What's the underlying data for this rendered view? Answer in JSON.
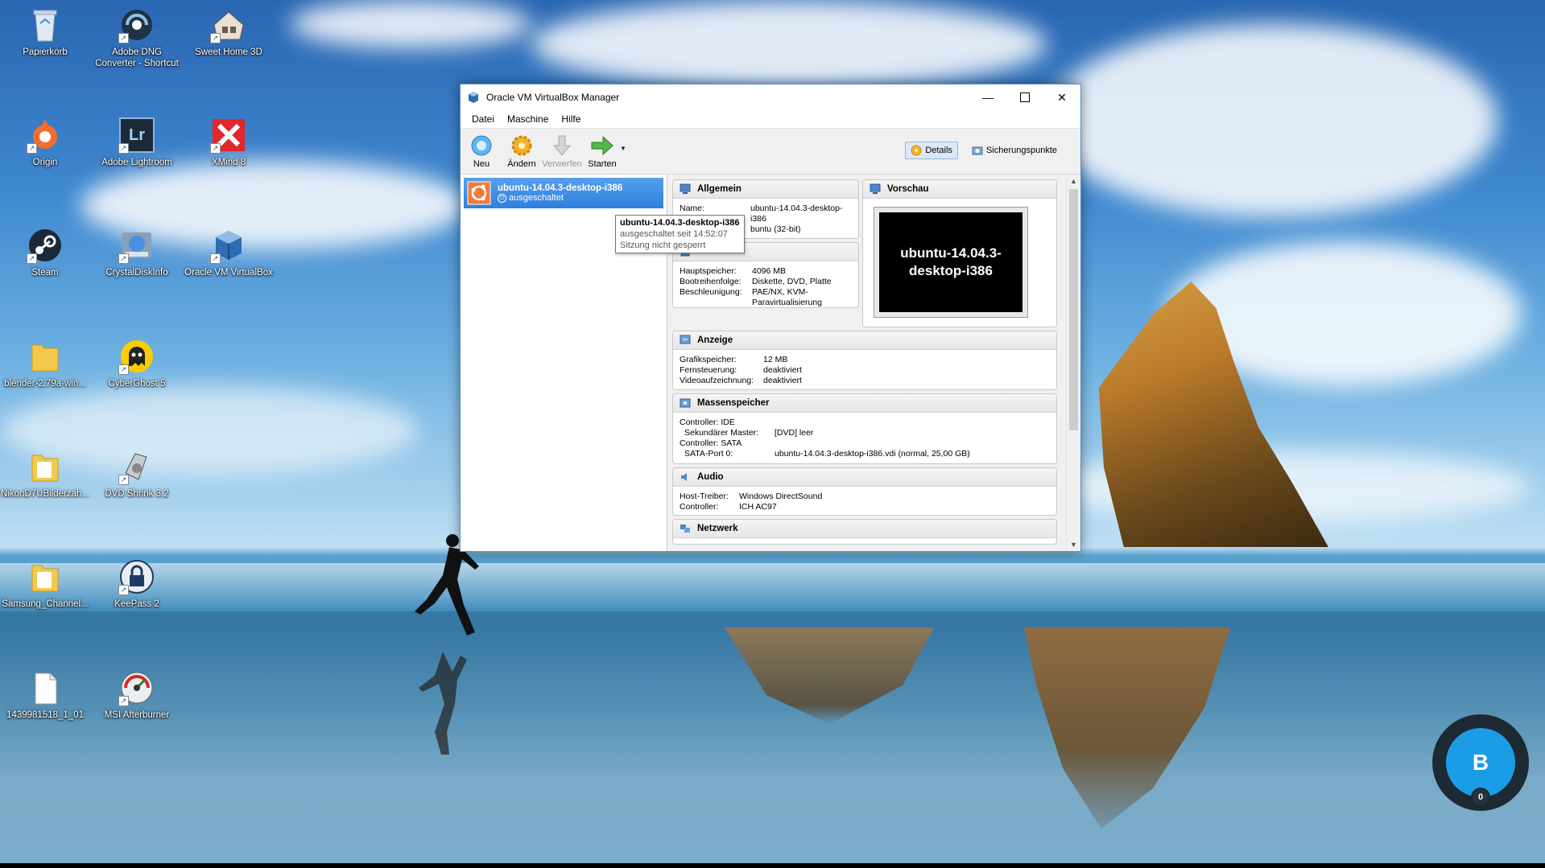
{
  "desktop": {
    "icons": [
      {
        "label": "Papierkorb",
        "icon": "recycle-bin-icon"
      },
      {
        "label": "Adobe DNG Converter - Shortcut",
        "icon": "adobe-dng-icon"
      },
      {
        "label": "Sweet Home 3D",
        "icon": "sweet-home-icon"
      },
      {
        "label": "Origin",
        "icon": "origin-icon"
      },
      {
        "label": "Adobe Lightroom",
        "icon": "lightroom-icon",
        "glyph": "Lr"
      },
      {
        "label": "XMind 8",
        "icon": "xmind-icon"
      },
      {
        "label": "Steam",
        "icon": "steam-icon"
      },
      {
        "label": "CrystalDiskInfo",
        "icon": "crystaldiskinfo-icon"
      },
      {
        "label": "Oracle VM VirtualBox",
        "icon": "virtualbox-icon"
      },
      {
        "label": "blender-2.79a-win...",
        "icon": "folder-icon"
      },
      {
        "label": "CyberGhost 5",
        "icon": "cyberghost-icon"
      },
      {
        "label": "NikonD7UBilderzah...",
        "icon": "folder-icon"
      },
      {
        "label": "DVD Shrink 3.2",
        "icon": "dvd-shrink-icon"
      },
      {
        "label": "Samsung_Channel...",
        "icon": "folder-icon"
      },
      {
        "label": "KeePass 2",
        "icon": "keepass-icon"
      },
      {
        "label": "1439981518_1_01",
        "icon": "file-icon"
      },
      {
        "label": "MSI Afterburner",
        "icon": "msi-afterburner-icon"
      }
    ]
  },
  "window": {
    "title": "Oracle VM VirtualBox Manager",
    "menu": [
      "Datei",
      "Maschine",
      "Hilfe"
    ],
    "toolbar": {
      "new_label": "Neu",
      "settings_label": "Ändern",
      "discard_label": "Verwerfen",
      "start_label": "Starten",
      "details_label": "Details",
      "snapshots_label": "Sicherungspunkte"
    },
    "vm": {
      "name": "ubuntu-14.04.3-desktop-i386",
      "state": "ausgeschaltet"
    },
    "tooltip": {
      "title": "ubuntu-14.04.3-desktop-i386",
      "line1": "ausgeschaltet seit 14:52:07",
      "line2": "Sitzung nicht gesperrt"
    },
    "sections": {
      "general": {
        "title": "Allgemein",
        "name_key": "Name:",
        "name_val": "ubuntu-14.04.3-desktop-i386",
        "os_val": "buntu (32-bit)"
      },
      "system": {
        "memory_key": "Hauptspeicher:",
        "memory_val": "4096 MB",
        "boot_key": "Bootreihenfolge:",
        "boot_val": "Diskette, DVD, Platte",
        "accel_key": "Beschleunigung:",
        "accel_val": "PAE/NX, KVM-Paravirtualisierung"
      },
      "preview": {
        "title": "Vorschau",
        "screen_text": "ubuntu-14.04.3-desktop-i386"
      },
      "display": {
        "title": "Anzeige",
        "vram_key": "Grafikspeicher:",
        "vram_val": "12 MB",
        "remote_key": "Fernsteuerung:",
        "remote_val": "deaktiviert",
        "capture_key": "Videoaufzeichnung:",
        "capture_val": "deaktiviert"
      },
      "storage": {
        "title": "Massenspeicher",
        "ctrl_ide": "Controller: IDE",
        "sec_master_key": "Sekundärer Master:",
        "sec_master_val": "[DVD] leer",
        "ctrl_sata": "Controller: SATA",
        "sata_port_key": "SATA-Port 0:",
        "sata_port_val": "ubuntu-14.04.3-desktop-i386.vdi (normal, 25,00 GB)"
      },
      "audio": {
        "title": "Audio",
        "host_key": "Host-Treiber:",
        "host_val": "Windows DirectSound",
        "ctrl_key": "Controller:",
        "ctrl_val": "ICH AC97"
      },
      "network": {
        "title": "Netzwerk"
      }
    }
  },
  "badge": {
    "letter": "B",
    "count": "0",
    "color": "#1a9de6"
  }
}
